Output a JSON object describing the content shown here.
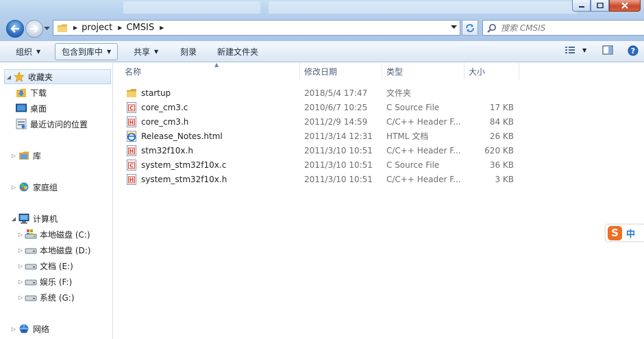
{
  "address": {
    "crumbs": [
      "project",
      "CMSIS"
    ],
    "search_placeholder": "搜索 CMSIS"
  },
  "toolbar": {
    "organize": "组织",
    "include_library": "包含到库中",
    "share": "共享",
    "burn": "刻录",
    "new_folder": "新建文件夹"
  },
  "sidebar": {
    "favorites": "收藏夹",
    "downloads": "下载",
    "desktop": "桌面",
    "recent": "最近访问的位置",
    "libraries": "库",
    "homegroup": "家庭组",
    "computer": "计算机",
    "drive_c": "本地磁盘 (C:)",
    "drive_d": "本地磁盘 (D:)",
    "drive_e": "文档 (E:)",
    "drive_f": "娱乐 (F:)",
    "drive_g": "系统 (G:)",
    "network": "网络"
  },
  "columns": {
    "name": "名称",
    "modified": "修改日期",
    "type": "类型",
    "size": "大小"
  },
  "files": [
    {
      "name": "startup",
      "modified": "2018/5/4 17:47",
      "type": "文件夹",
      "size": "",
      "icon": "folder-icon"
    },
    {
      "name": "core_cm3.c",
      "modified": "2010/6/7 10:25",
      "type": "C Source File",
      "size": "17 KB",
      "icon": "c-file-icon"
    },
    {
      "name": "core_cm3.h",
      "modified": "2011/2/9 14:59",
      "type": "C/C++ Header F...",
      "size": "84 KB",
      "icon": "h-file-icon"
    },
    {
      "name": "Release_Notes.html",
      "modified": "2011/3/14 12:31",
      "type": "HTML 文档",
      "size": "26 KB",
      "icon": "html-file-icon"
    },
    {
      "name": "stm32f10x.h",
      "modified": "2011/3/10 10:51",
      "type": "C/C++ Header F...",
      "size": "620 KB",
      "icon": "h-file-icon"
    },
    {
      "name": "system_stm32f10x.c",
      "modified": "2011/3/10 10:51",
      "type": "C Source File",
      "size": "36 KB",
      "icon": "c-file-icon"
    },
    {
      "name": "system_stm32f10x.h",
      "modified": "2011/3/10 10:51",
      "type": "C/C++ Header F...",
      "size": "3 KB",
      "icon": "h-file-icon"
    }
  ],
  "ime": {
    "brand": "S",
    "mode": "中"
  },
  "colors": {
    "chrome": "#b4cfec",
    "toolbar": "#e7eff8",
    "selection": "#dbe9f8",
    "ime_orange": "#f06d22"
  }
}
